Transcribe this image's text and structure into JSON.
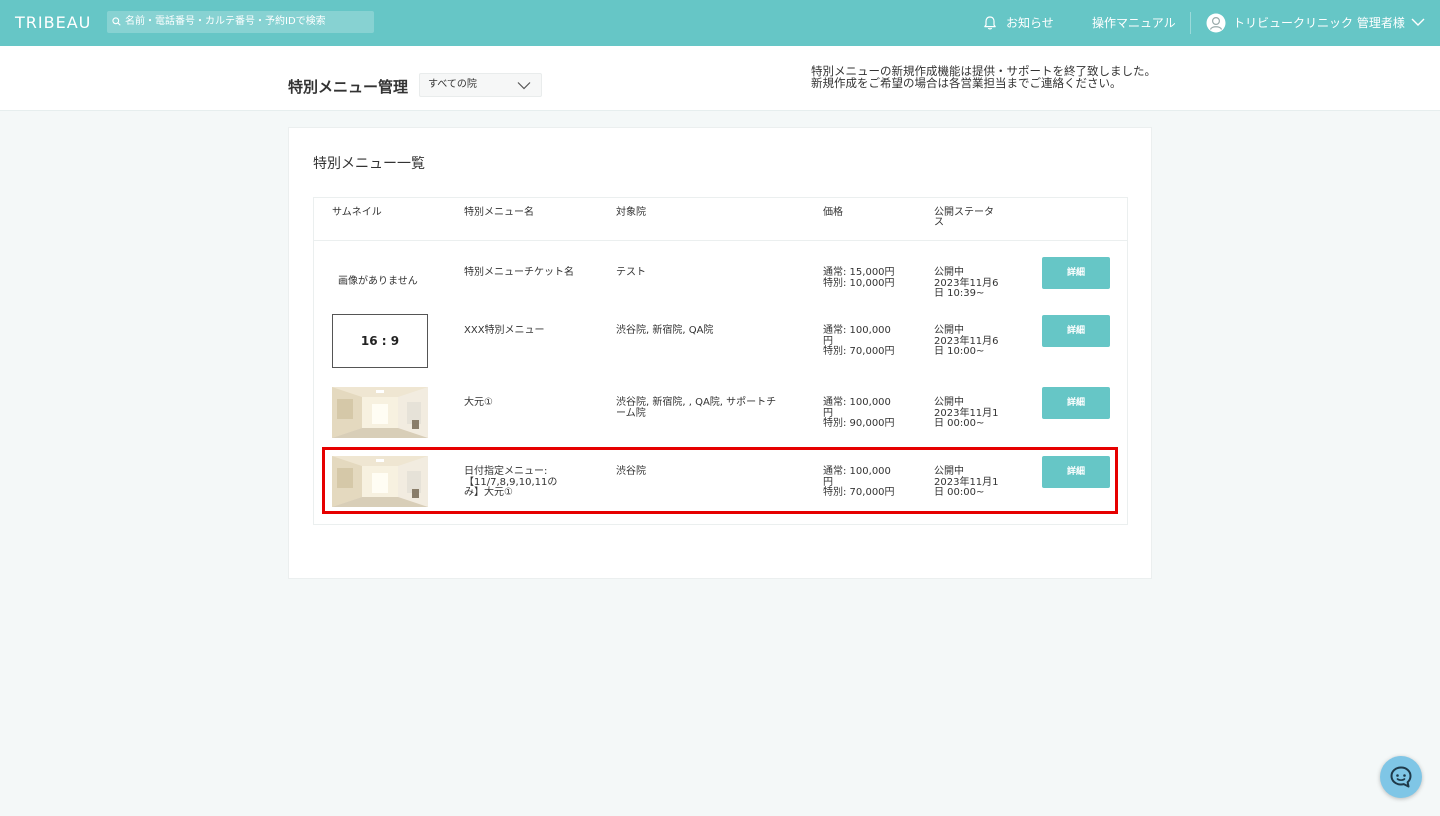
{
  "topbar": {
    "logo": "TRIBEAU",
    "search_placeholder": "名前・電話番号・カルテ番号・予約IDで検索",
    "notice_label": "お知らせ",
    "manual_label": "操作マニュアル",
    "user_label": "トリビュークリニック 管理者様"
  },
  "header": {
    "title": "特別メニュー管理",
    "clinic_select": "すべての院",
    "announcement_line1": "特別メニューの新規作成機能は提供・サポートを終了致しました。",
    "announcement_line2": "新規作成をご希望の場合は各営業担当までご連絡ください。"
  },
  "list": {
    "title": "特別メニュー一覧",
    "columns": {
      "thumbnail": "サムネイル",
      "name": "特別メニュー名",
      "clinics": "対象院",
      "price": "価格",
      "status_1": "公開ステータ",
      "status_2": "ス"
    },
    "rows": [
      {
        "thumbnail_text": "画像がありません",
        "name_1": "特別メニューチケット名",
        "name_2": "",
        "name_3": "",
        "clinics_1": "テスト",
        "clinics_2": "",
        "price_1": "通常: 15,000円",
        "price_2": "特別: 10,000円",
        "price_3": "",
        "status_1": "公開中",
        "status_2": "2023年11月6",
        "status_3": "日 10:39~",
        "button": "詳細"
      },
      {
        "thumbnail_text": "16 : 9",
        "name_1": "XXX特別メニュー",
        "name_2": "",
        "name_3": "",
        "clinics_1": "渋谷院, 新宿院, QA院",
        "clinics_2": "",
        "price_1": "通常: 100,000",
        "price_2": "円",
        "price_3": "特別: 70,000円",
        "status_1": "公開中",
        "status_2": "2023年11月6",
        "status_3": "日 10:00~",
        "button": "詳細"
      },
      {
        "thumbnail_text": "",
        "name_1": "大元①",
        "name_2": "",
        "name_3": "",
        "clinics_1": "渋谷院, 新宿院, , QA院, サポートチ",
        "clinics_2": "ーム院",
        "price_1": "通常: 100,000",
        "price_2": "円",
        "price_3": "特別: 90,000円",
        "status_1": "公開中",
        "status_2": "2023年11月1",
        "status_3": "日 00:00~",
        "button": "詳細"
      },
      {
        "thumbnail_text": "",
        "name_1": "日付指定メニュー:",
        "name_2": "【11/7,8,9,10,11の",
        "name_3": "み】大元①",
        "clinics_1": "渋谷院",
        "clinics_2": "",
        "price_1": "通常: 100,000",
        "price_2": "円",
        "price_3": "特別: 70,000円",
        "status_1": "公開中",
        "status_2": "2023年11月1",
        "status_3": "日 00:00~",
        "button": "詳細"
      }
    ]
  },
  "colors": {
    "brand": "#66c6c6",
    "highlight": "#e60000",
    "chat": "#7fc6e6"
  }
}
